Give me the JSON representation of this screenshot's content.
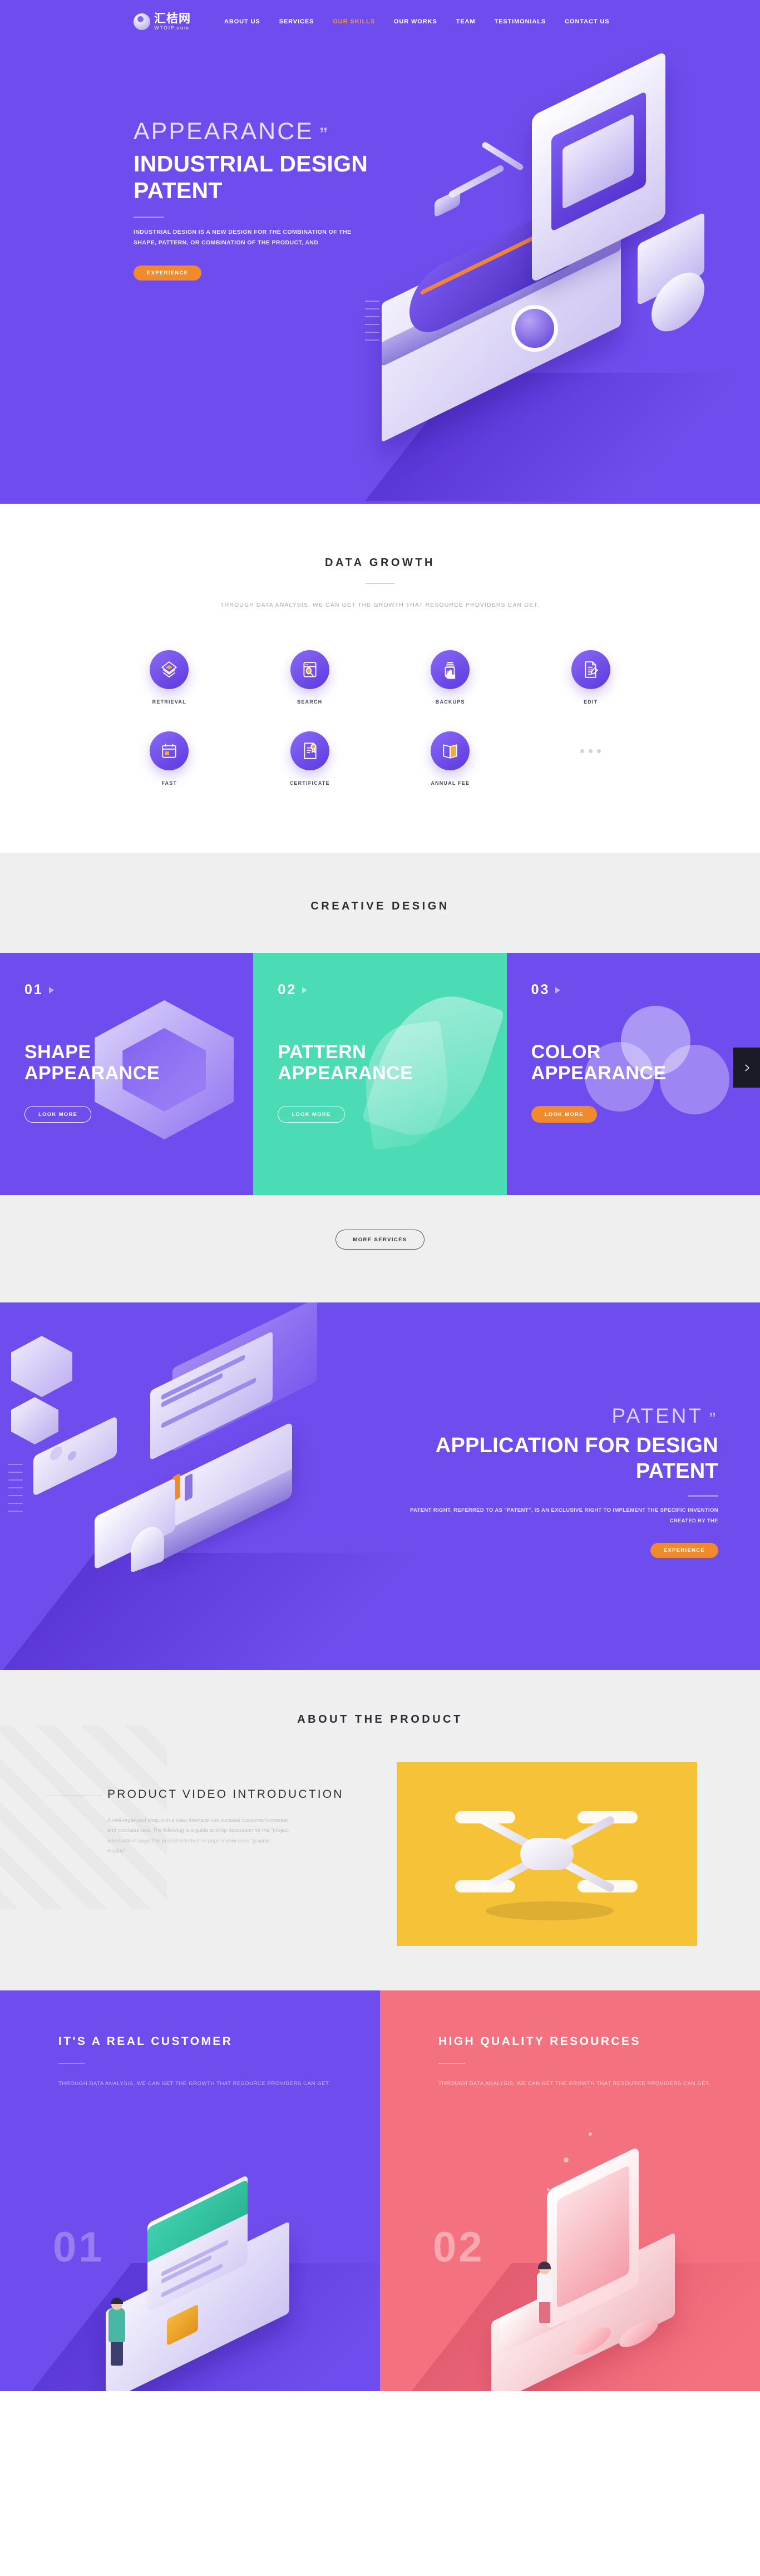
{
  "brand": {
    "logo_cn": "汇桔网",
    "logo_en": "WTOIP.com",
    "accent_orange": "#f08a2b",
    "accent_purple": "#6f4ced",
    "accent_mint": "#4bdcb5",
    "accent_pink": "#f4717f",
    "accent_yellow": "#f6c238"
  },
  "nav": {
    "items": [
      {
        "label": "ABOUT US",
        "active": false
      },
      {
        "label": "SERVICES",
        "active": false
      },
      {
        "label": "OUR SKILLS",
        "active": true
      },
      {
        "label": "OUR WORKS",
        "active": false
      },
      {
        "label": "TEAM",
        "active": false
      },
      {
        "label": "TESTIMONIALS",
        "active": false
      },
      {
        "label": "CONTACT US",
        "active": false
      }
    ]
  },
  "hero": {
    "kicker": "APPEARANCE",
    "quote_mark": "”",
    "title": "INDUSTRIAL DESIGN PATENT",
    "description": "INDUSTRIAL DESIGN IS A NEW DESIGN FOR THE COMBINATION OF THE SHAPE, PATTERN, OR COMBINATION OF THE PRODUCT, AND",
    "cta": "EXPERIENCE"
  },
  "data_growth": {
    "title": "DATA GROWTH",
    "subtitle": "THROUGH DATA ANALYSIS, WE CAN GET THE GROWTH THAT RESOURCE PROVIDERS CAN GET.",
    "items": [
      {
        "label": "RETRIEVAL",
        "icon": "layers-icon"
      },
      {
        "label": "SEARCH",
        "icon": "browser-search-icon"
      },
      {
        "label": "BACKUPS",
        "icon": "hand-document-icon"
      },
      {
        "label": "EDIT",
        "icon": "document-pencil-icon"
      },
      {
        "label": "FAST",
        "icon": "calendar-icon"
      },
      {
        "label": "CERTIFICATE",
        "icon": "certificate-icon"
      },
      {
        "label": "ANNUAL FEE",
        "icon": "book-icon"
      }
    ],
    "more_dots": "• • •"
  },
  "creative": {
    "title": "CREATIVE DESIGN",
    "cards": [
      {
        "number": "01",
        "title": "SHAPE APPEARANCE",
        "cta": "LOOK MORE",
        "style": "purple",
        "btn": "ghost"
      },
      {
        "number": "02",
        "title": "PATTERN APPEARANCE",
        "cta": "LOOK MORE",
        "style": "mint",
        "btn": "ghost"
      },
      {
        "number": "03",
        "title": "COLOR APPEARANCE",
        "cta": "LOOK MORE",
        "style": "purple",
        "btn": "solid"
      }
    ],
    "next_label": "›",
    "more_services": "MORE SERVICES"
  },
  "patent": {
    "kicker": "PATENT",
    "quote_mark": "”",
    "title": "APPLICATION FOR DESIGN PATENT",
    "description": "PATENT RIGHT, REFERRED TO AS \"PATENT\", IS AN EXCLUSIVE RIGHT TO IMPLEMENT THE SPECIFIC INVENTION CREATED BY THE",
    "cta": "EXPERIENCE"
  },
  "about": {
    "title": "ABOUT THE PRODUCT",
    "heading": "PRODUCT VIDEO INTRODUCTION",
    "paragraph": "A well-organized shop with a clear interface can increase consumer's interest and purchase rate. The following is a guide to shop decoration for the \"project introduction\" page.The project introduction page mainly uses \"graphic display\"."
  },
  "panels": [
    {
      "title": "IT'S A REAL CUSTOMER",
      "paragraph": "THROUGH DATA ANALYSIS, WE CAN GET THE GROWTH THAT RESOURCE PROVIDERS CAN GET.",
      "number": "01"
    },
    {
      "title": "HIGH QUALITY RESOURCES",
      "paragraph": "THROUGH DATA ANALYSIS, WE CAN GET THE GROWTH THAT RESOURCE PROVIDERS CAN GET.",
      "number": "02"
    }
  ]
}
